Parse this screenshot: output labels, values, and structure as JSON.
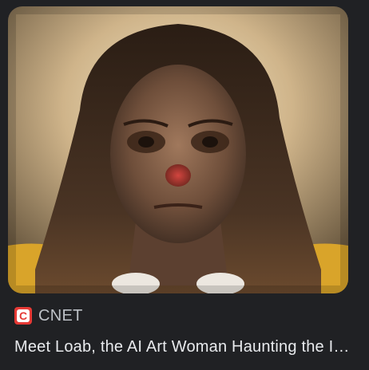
{
  "card": {
    "image_alt": "AI-generated portrait of Loab",
    "source": {
      "name": "CNET",
      "favicon": "cnet-logo-icon",
      "favicon_letter": "C",
      "favicon_color": "#e53935"
    },
    "title": "Meet Loab, the AI Art Woman Haunting the Internet"
  }
}
